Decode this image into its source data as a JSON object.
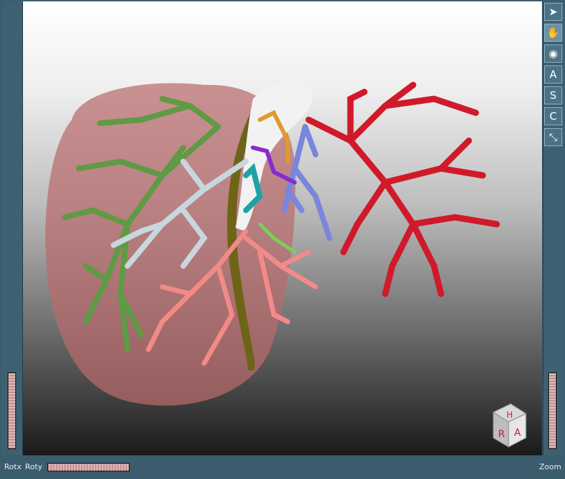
{
  "toolbar": {
    "items": [
      {
        "name": "select-arrow",
        "glyph": "➤",
        "active": false
      },
      {
        "name": "hand",
        "glyph": "✋",
        "active": true
      },
      {
        "name": "view-all",
        "glyph": "◉",
        "active": false
      },
      {
        "name": "axial",
        "glyph": "A",
        "active": false
      },
      {
        "name": "sagittal",
        "glyph": "S",
        "active": false
      },
      {
        "name": "coronal",
        "glyph": "C",
        "active": false
      },
      {
        "name": "seek",
        "glyph": "⤡",
        "active": false
      }
    ]
  },
  "bottom": {
    "rotx_label": "Rotx",
    "roty_label": "Roty",
    "zoom_label": "Zoom"
  },
  "orientation_cube": {
    "top": "H",
    "left": "R",
    "right": "A"
  },
  "colors": {
    "liver": "#b86b6b",
    "portal_vein": "#5f9a45",
    "hepatic_vein": "#c8d6de",
    "artery": "#d01a2a",
    "vein_blue": "#7a86db",
    "salmon": "#f28a8a",
    "teal": "#1ba3a8",
    "orange": "#e09a2c",
    "purple": "#8a2bd0",
    "cut_plane": "#6e6418",
    "background_top": "#ffffff",
    "background_bottom": "#141414"
  }
}
